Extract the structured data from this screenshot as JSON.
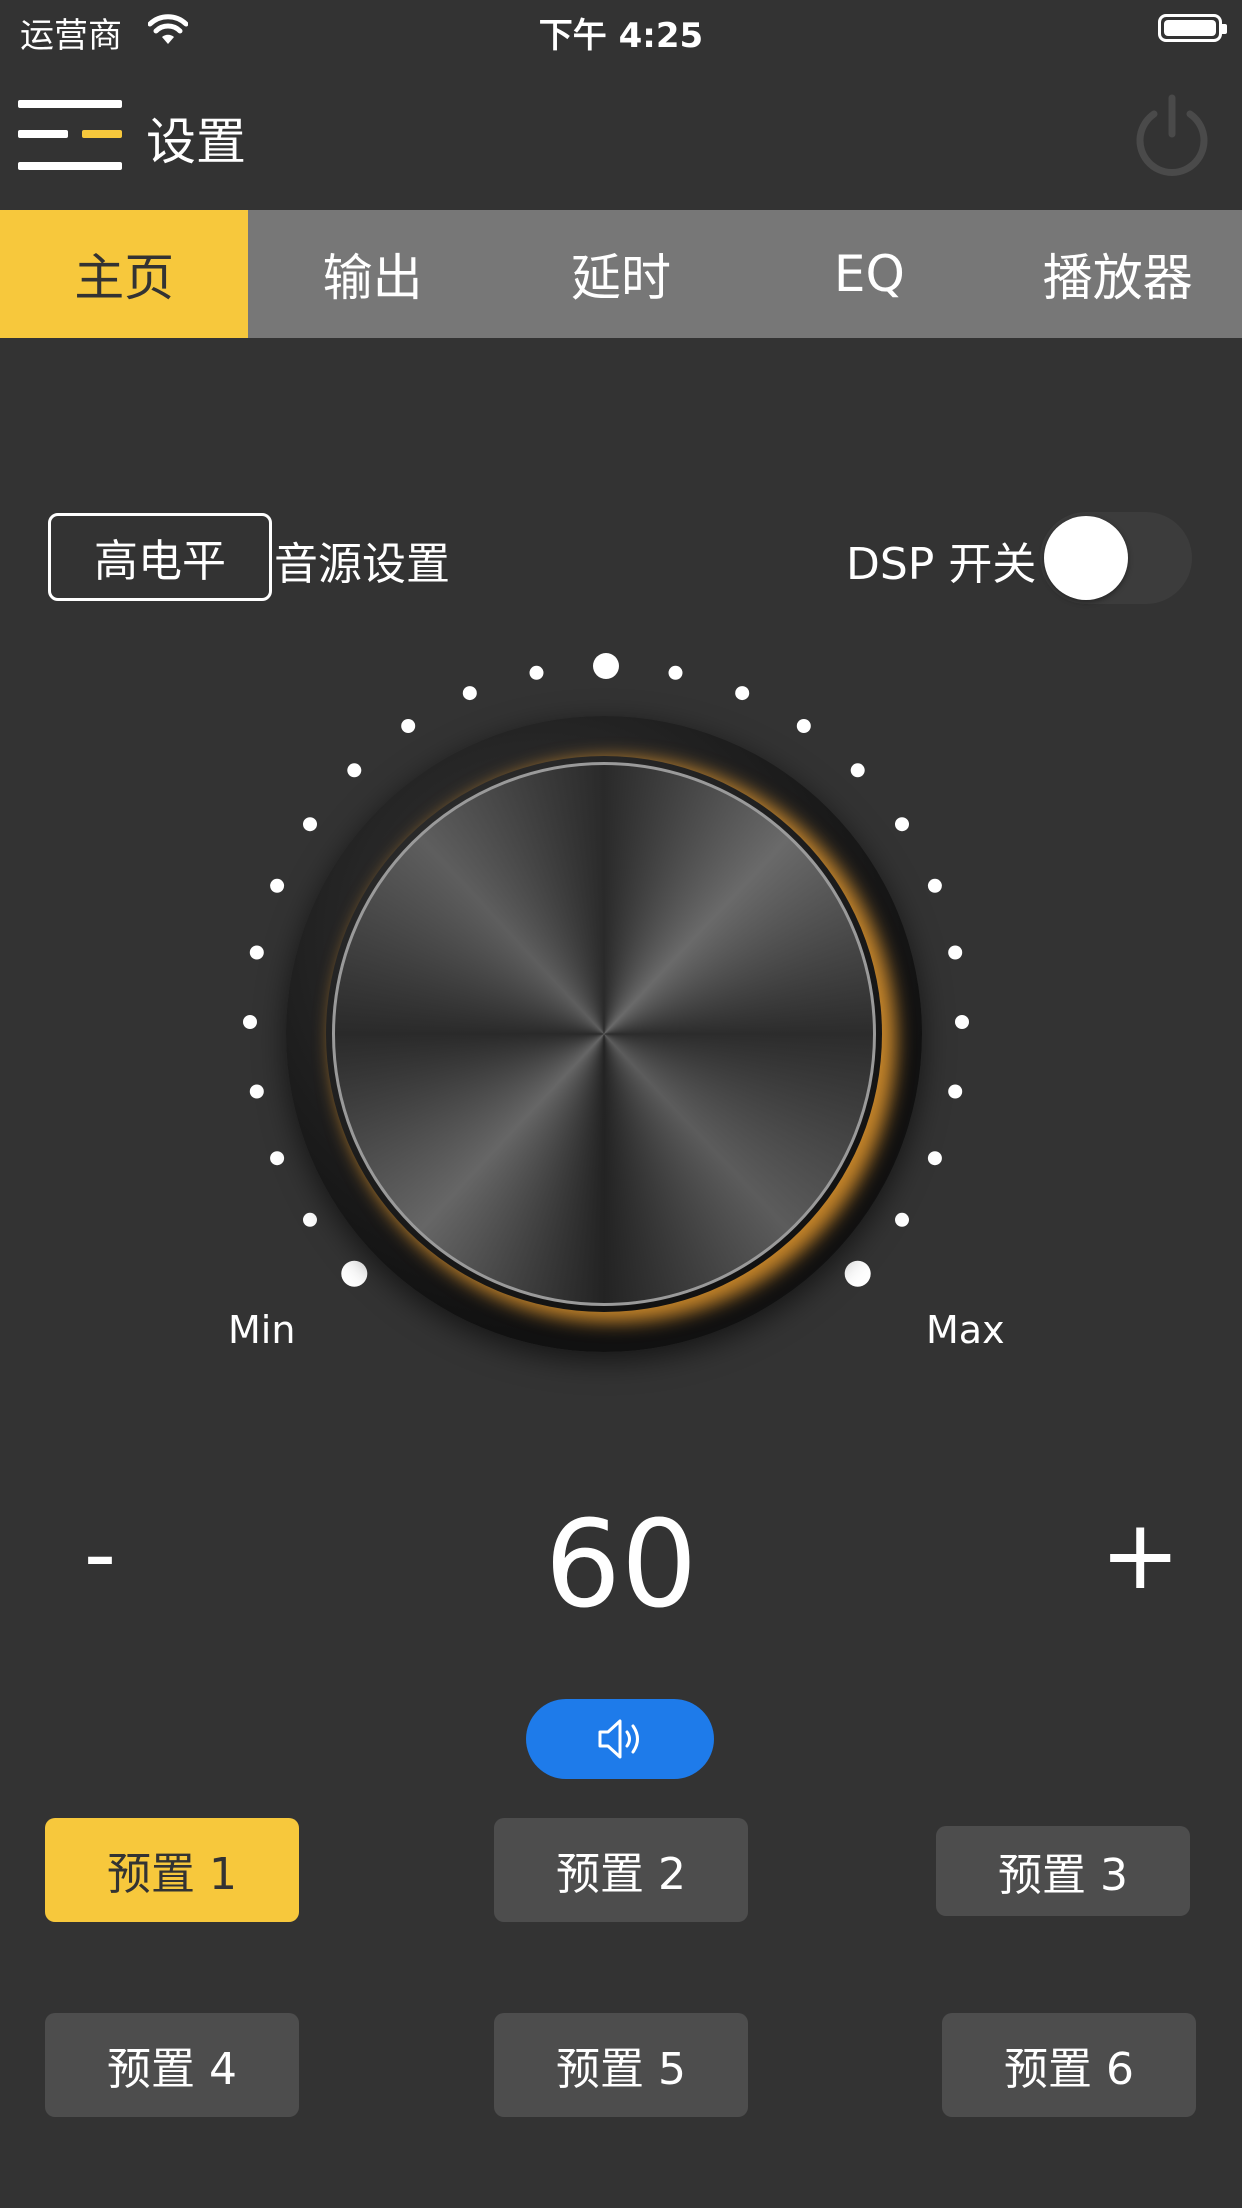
{
  "status_bar": {
    "carrier": "运营商",
    "time": "下午 4:25"
  },
  "header": {
    "title": "设置"
  },
  "tabs": [
    {
      "label": "主页",
      "active": true
    },
    {
      "label": "输出",
      "active": false
    },
    {
      "label": "延时",
      "active": false
    },
    {
      "label": "EQ",
      "active": false
    },
    {
      "label": "播放器",
      "active": false
    }
  ],
  "source": {
    "level_button": "高电平",
    "label": "音源设置"
  },
  "dsp": {
    "label": "DSP 开关",
    "on": false
  },
  "knob": {
    "min_label": "Min",
    "max_label": "Max"
  },
  "volume": {
    "minus": "-",
    "value": "60",
    "plus": "+"
  },
  "presets": [
    {
      "label": "预置 1",
      "active": true
    },
    {
      "label": "预置 2",
      "active": false
    },
    {
      "label": "预置 3",
      "active": false
    },
    {
      "label": "预置 4",
      "active": false
    },
    {
      "label": "预置 5",
      "active": false
    },
    {
      "label": "预置 6",
      "active": false
    }
  ],
  "colors": {
    "background": "#333333",
    "accent": "#F7C83C",
    "tabbar": "#777777",
    "mute_button": "#1E7BEA",
    "preset": "#4D4D4D"
  },
  "icons": {
    "menu": "menu-icon",
    "power": "power-icon",
    "mute": "speaker-icon",
    "wifi": "wifi-icon",
    "battery": "battery-icon"
  }
}
